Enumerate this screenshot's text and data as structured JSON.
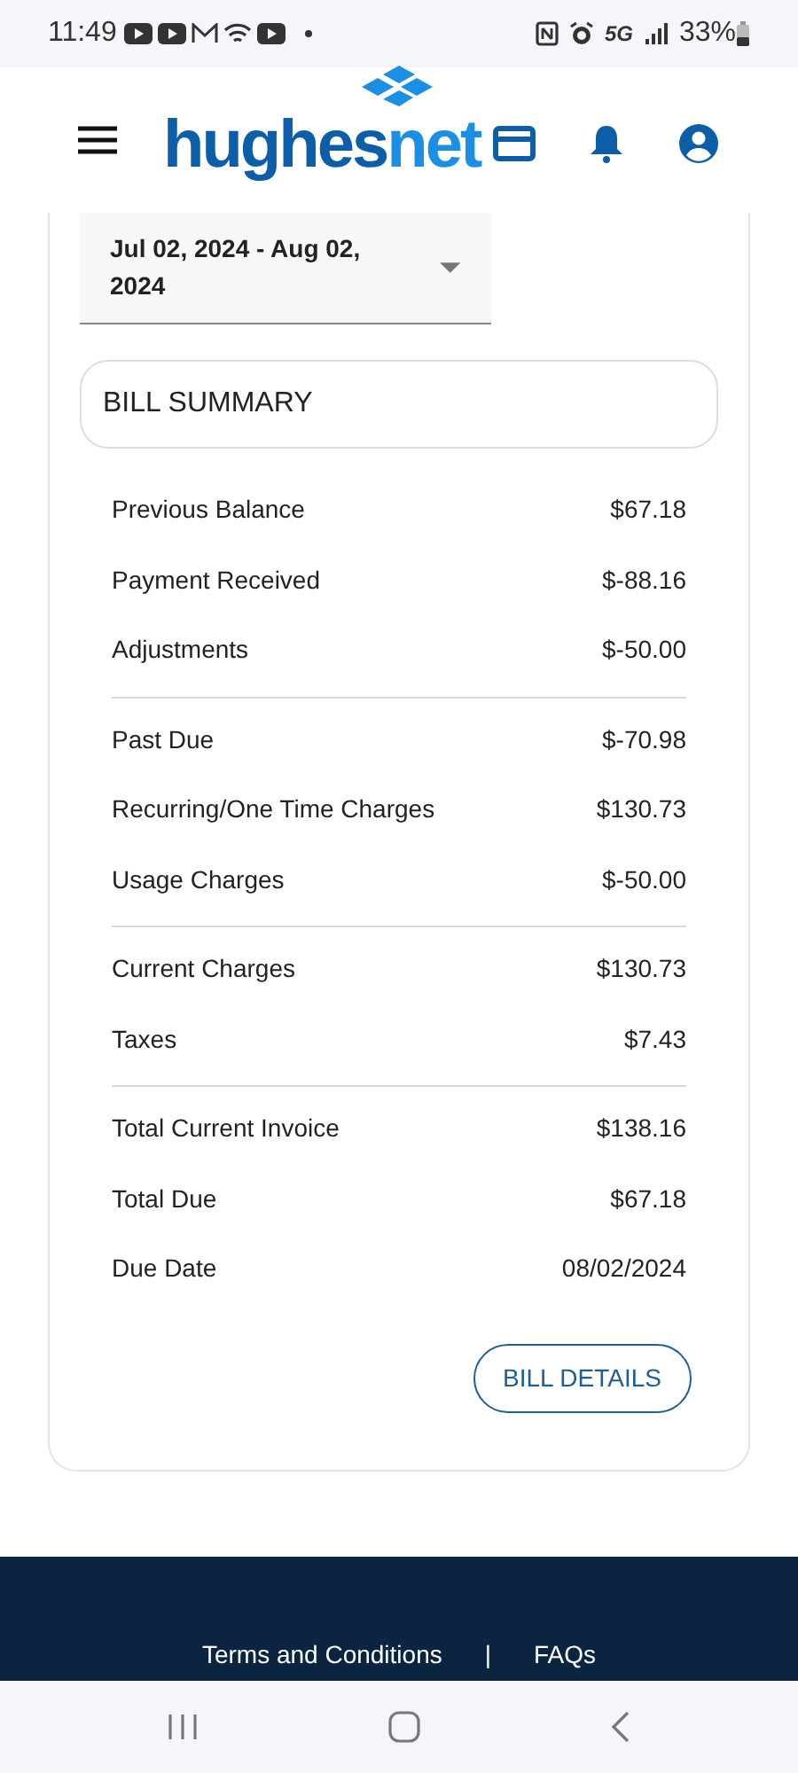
{
  "status_bar": {
    "time": "11:49",
    "network": "5G",
    "battery": "33%"
  },
  "header": {
    "logo": [
      "hughes",
      "net"
    ]
  },
  "period": {
    "value": "Jul 02, 2024 - Aug 02, 2024"
  },
  "summary": {
    "title": "BILL SUMMARY",
    "groups": [
      [
        {
          "label": "Previous Balance",
          "amount": "$67.18"
        },
        {
          "label": "Payment Received",
          "amount": "$-88.16"
        },
        {
          "label": "Adjustments",
          "amount": "$-50.00"
        }
      ],
      [
        {
          "label": "Past Due",
          "amount": "$-70.98"
        },
        {
          "label": "Recurring/One Time Charges",
          "amount": "$130.73"
        },
        {
          "label": "Usage Charges",
          "amount": "$-50.00"
        }
      ],
      [
        {
          "label": "Current Charges",
          "amount": "$130.73"
        },
        {
          "label": "Taxes",
          "amount": "$7.43"
        }
      ],
      [
        {
          "label": "Total Current Invoice",
          "amount": "$138.16"
        },
        {
          "label": "Total Due",
          "amount": "$67.18"
        },
        {
          "label": "Due Date",
          "amount": "08/02/2024"
        }
      ]
    ],
    "button": "BILL DETAILS"
  },
  "footer": {
    "links": [
      "Terms and Conditions",
      "FAQs"
    ],
    "separator": "|"
  }
}
